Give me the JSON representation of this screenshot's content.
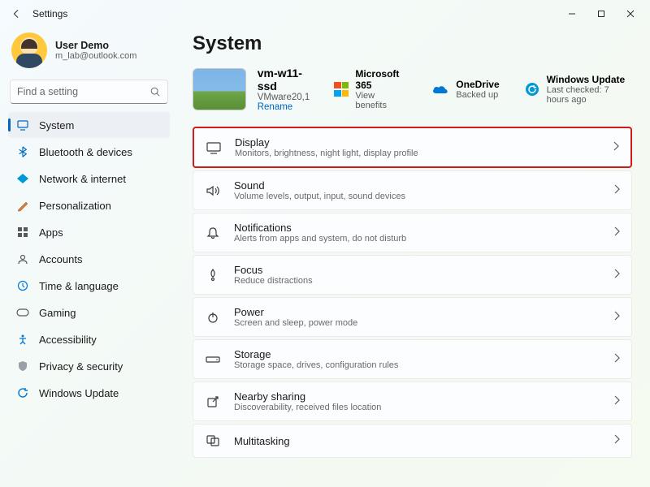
{
  "titlebar": {
    "title": "Settings"
  },
  "user": {
    "name": "User Demo",
    "email": "m_lab@outlook.com"
  },
  "search": {
    "placeholder": "Find a setting"
  },
  "nav": [
    {
      "label": "System"
    },
    {
      "label": "Bluetooth & devices"
    },
    {
      "label": "Network & internet"
    },
    {
      "label": "Personalization"
    },
    {
      "label": "Apps"
    },
    {
      "label": "Accounts"
    },
    {
      "label": "Time & language"
    },
    {
      "label": "Gaming"
    },
    {
      "label": "Accessibility"
    },
    {
      "label": "Privacy & security"
    },
    {
      "label": "Windows Update"
    }
  ],
  "page": {
    "title": "System"
  },
  "device": {
    "name": "vm-w11-ssd",
    "model": "VMware20,1",
    "rename": "Rename"
  },
  "pills": {
    "m365": {
      "title": "Microsoft 365",
      "sub": "View benefits"
    },
    "onedrive": {
      "title": "OneDrive",
      "sub": "Backed up"
    },
    "update": {
      "title": "Windows Update",
      "sub": "Last checked: 7 hours ago"
    }
  },
  "cards": [
    {
      "title": "Display",
      "sub": "Monitors, brightness, night light, display profile"
    },
    {
      "title": "Sound",
      "sub": "Volume levels, output, input, sound devices"
    },
    {
      "title": "Notifications",
      "sub": "Alerts from apps and system, do not disturb"
    },
    {
      "title": "Focus",
      "sub": "Reduce distractions"
    },
    {
      "title": "Power",
      "sub": "Screen and sleep, power mode"
    },
    {
      "title": "Storage",
      "sub": "Storage space, drives, configuration rules"
    },
    {
      "title": "Nearby sharing",
      "sub": "Discoverability, received files location"
    },
    {
      "title": "Multitasking",
      "sub": ""
    }
  ]
}
